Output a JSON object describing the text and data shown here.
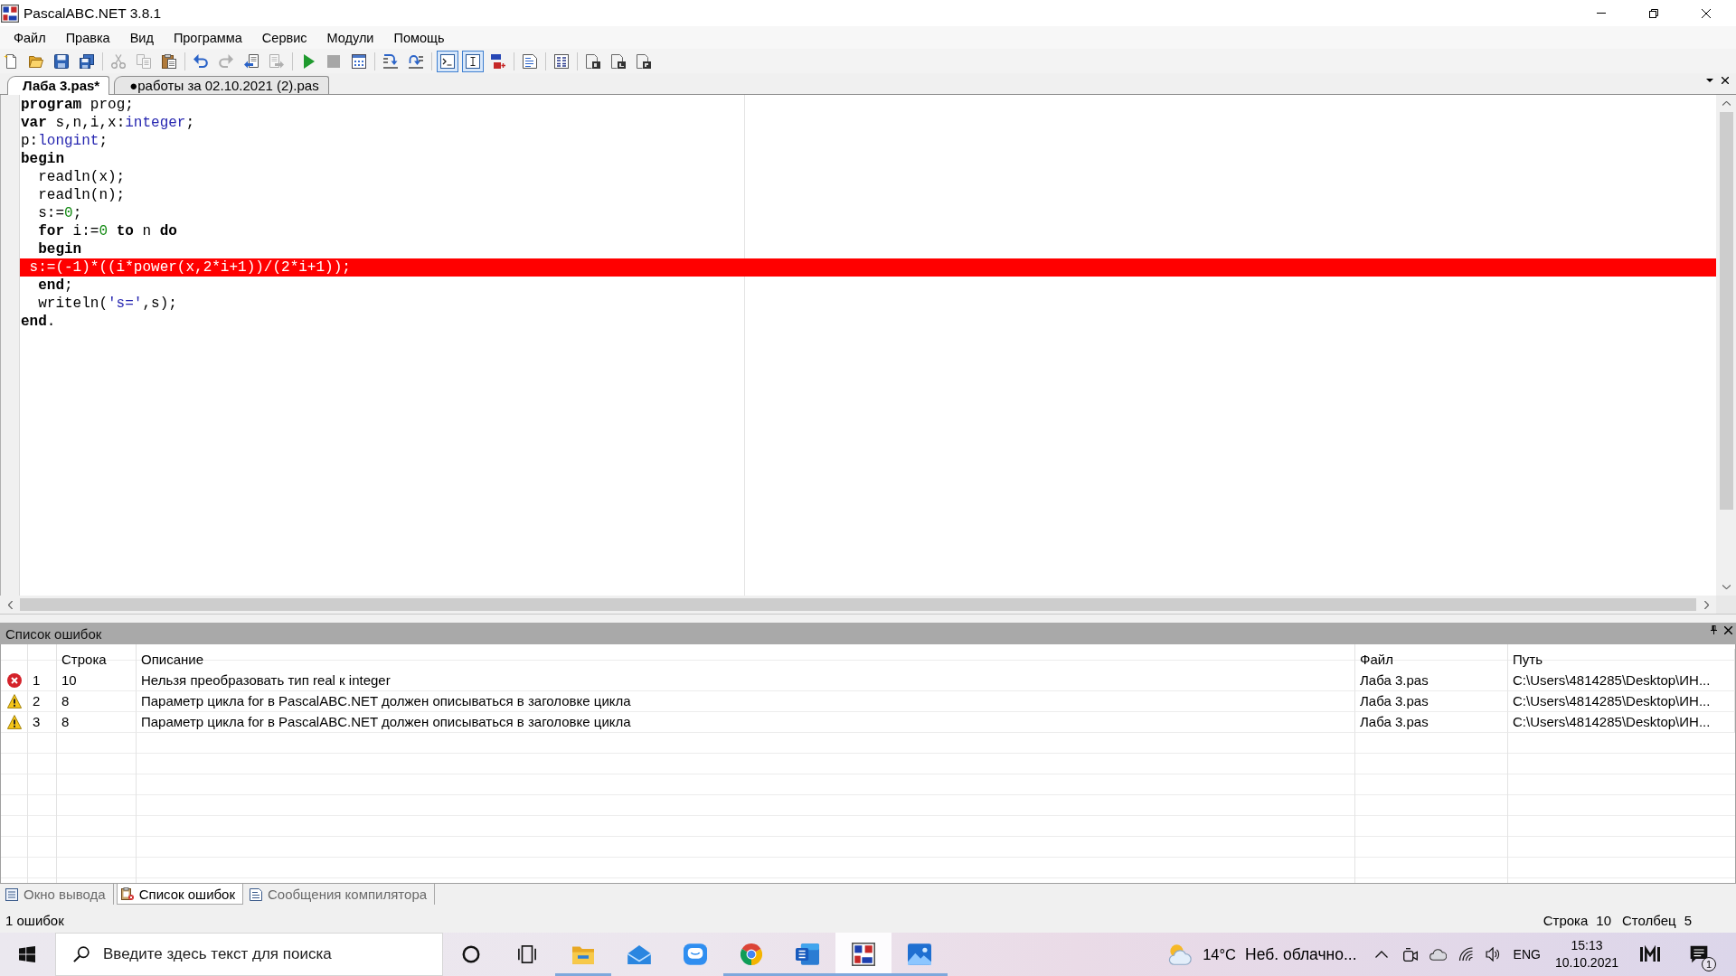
{
  "window": {
    "title": "PascalABC.NET 3.8.1"
  },
  "menu": [
    "Файл",
    "Правка",
    "Вид",
    "Программа",
    "Сервис",
    "Модули",
    "Помощь"
  ],
  "toolbar": [
    {
      "buttons": [
        {
          "disabled": false,
          "on": false
        },
        {
          "disabled": false,
          "on": false
        },
        {
          "disabled": false,
          "on": false
        },
        {
          "disabled": false,
          "on": false
        }
      ]
    },
    {
      "buttons": [
        {
          "disabled": true,
          "on": false
        },
        {
          "disabled": true,
          "on": false
        },
        {
          "disabled": false,
          "on": false
        }
      ]
    },
    {
      "buttons": [
        {
          "disabled": false,
          "on": false
        },
        {
          "disabled": true,
          "on": false
        },
        {
          "disabled": false,
          "on": false
        },
        {
          "disabled": true,
          "on": false
        }
      ]
    },
    {
      "buttons": [
        {
          "disabled": false,
          "on": false
        },
        {
          "disabled": true,
          "on": false
        },
        {
          "disabled": false,
          "on": false
        }
      ]
    },
    {
      "buttons": [
        {
          "disabled": false,
          "on": false
        },
        {
          "disabled": false,
          "on": false
        }
      ]
    },
    {
      "buttons": [
        {
          "disabled": false,
          "on": true
        },
        {
          "disabled": false,
          "on": true
        },
        {
          "disabled": false,
          "on": false
        }
      ]
    },
    {
      "buttons": [
        {
          "disabled": false,
          "on": false
        }
      ]
    },
    {
      "buttons": [
        {
          "disabled": false,
          "on": false
        }
      ]
    },
    {
      "buttons": [
        {
          "disabled": false,
          "on": false
        },
        {
          "disabled": false,
          "on": false
        },
        {
          "disabled": false,
          "on": false
        }
      ]
    }
  ],
  "editor_tabs": [
    {
      "label": "Лаба 3.pas*",
      "selected": true
    },
    {
      "label": "●работы за 02.10.2021 (2).pas",
      "selected": false
    }
  ],
  "editor": {
    "lines": [
      {
        "error": false,
        "tokens": [
          {
            "kind": "keyword",
            "text": "program"
          },
          {
            "kind": "plain",
            "text": " prog;"
          }
        ]
      },
      {
        "error": false,
        "tokens": [
          {
            "kind": "keyword",
            "text": "var"
          },
          {
            "kind": "plain",
            "text": " s,n,i,x:"
          },
          {
            "kind": "type",
            "text": "integer"
          },
          {
            "kind": "plain",
            "text": ";"
          }
        ]
      },
      {
        "error": false,
        "tokens": [
          {
            "kind": "plain",
            "text": "p:"
          },
          {
            "kind": "type",
            "text": "longint"
          },
          {
            "kind": "plain",
            "text": ";"
          }
        ]
      },
      {
        "error": false,
        "tokens": [
          {
            "kind": "keyword",
            "text": "begin"
          }
        ]
      },
      {
        "error": false,
        "tokens": [
          {
            "kind": "plain",
            "text": "  readln(x);"
          }
        ]
      },
      {
        "error": false,
        "tokens": [
          {
            "kind": "plain",
            "text": "  readln(n);"
          }
        ]
      },
      {
        "error": false,
        "tokens": [
          {
            "kind": "plain",
            "text": "  s:="
          },
          {
            "kind": "number",
            "text": "0"
          },
          {
            "kind": "plain",
            "text": ";"
          }
        ]
      },
      {
        "error": false,
        "tokens": [
          {
            "kind": "keyword",
            "text": "  for"
          },
          {
            "kind": "plain",
            "text": " i:="
          },
          {
            "kind": "number",
            "text": "0"
          },
          {
            "kind": "keyword",
            "text": " to"
          },
          {
            "kind": "plain",
            "text": " n "
          },
          {
            "kind": "keyword",
            "text": "do"
          }
        ]
      },
      {
        "error": false,
        "tokens": [
          {
            "kind": "keyword",
            "text": "  begin"
          }
        ]
      },
      {
        "error": true,
        "tokens": [
          {
            "kind": "plain",
            "text": " s:=(-1)*((i*power(x,2*i+1))/(2*i+1));"
          }
        ]
      },
      {
        "error": false,
        "tokens": [
          {
            "kind": "keyword",
            "text": "  end"
          },
          {
            "kind": "plain",
            "text": ";"
          }
        ]
      },
      {
        "error": false,
        "tokens": [
          {
            "kind": "plain",
            "text": "  writeln("
          },
          {
            "kind": "string",
            "text": "'s='"
          },
          {
            "kind": "plain",
            "text": ",s);"
          }
        ]
      },
      {
        "error": false,
        "tokens": [
          {
            "kind": "keyword",
            "text": "end"
          },
          {
            "kind": "plain",
            "text": "."
          }
        ]
      }
    ]
  },
  "error_panel": {
    "title": "Список ошибок",
    "columns": [
      "Строка",
      "Описание",
      "Файл",
      "Путь"
    ],
    "rows": [
      {
        "kind": "error",
        "number": "1",
        "line": "10",
        "description": "Нельзя преобразовать тип real к integer",
        "file": "Лаба 3.pas",
        "path": "C:\\Users\\4814285\\Desktop\\ИН..."
      },
      {
        "kind": "warning",
        "number": "2",
        "line": "8",
        "description": "Параметр цикла for в PascalABC.NET должен описываться в заголовке цикла",
        "file": "Лаба 3.pas",
        "path": "C:\\Users\\4814285\\Desktop\\ИН..."
      },
      {
        "kind": "warning",
        "number": "3",
        "line": "8",
        "description": "Параметр цикла for в PascalABC.NET должен описываться в заголовке цикла",
        "file": "Лаба 3.pas",
        "path": "C:\\Users\\4814285\\Desktop\\ИН..."
      }
    ]
  },
  "output_tabs": [
    {
      "label": "Окно вывода",
      "selected": false
    },
    {
      "label": "Список ошибок",
      "selected": true
    },
    {
      "label": "Сообщения компилятора",
      "selected": false
    }
  ],
  "status_bar": {
    "message": "1 ошибок",
    "line_label": "Строка",
    "line": "10",
    "column_label": "Столбец",
    "column": "5"
  },
  "taskbar": {
    "search": {
      "placeholder": "Введите здесь текст для поиска"
    },
    "apps": [
      {
        "running": true,
        "active": false
      },
      {
        "running": false,
        "active": false
      },
      {
        "running": false,
        "active": false
      },
      {
        "running": true,
        "active": false
      },
      {
        "running": true,
        "active": false
      },
      {
        "running": true,
        "active": true
      },
      {
        "running": true,
        "active": false
      }
    ],
    "weather": {
      "temperature": "14°C",
      "condition": "Неб. облачно..."
    },
    "language": "ENG",
    "time": "15:13",
    "date": "10.10.2021",
    "notifications": "1"
  }
}
